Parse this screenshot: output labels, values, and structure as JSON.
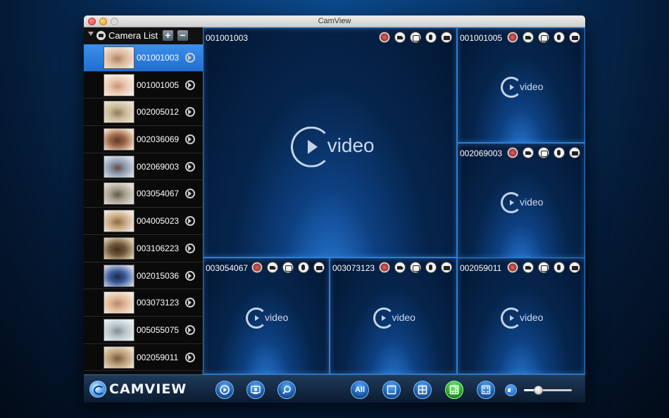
{
  "window": {
    "title": "CamView"
  },
  "sidebar": {
    "title": "Camera List",
    "add_label": "+",
    "remove_label": "−",
    "cameras": [
      {
        "id": "001001003",
        "selected": true,
        "thumb": [
          "#d9b89a",
          "#f2e4d6",
          "#b08064"
        ]
      },
      {
        "id": "001001005",
        "selected": false,
        "thumb": [
          "#e8c4a8",
          "#f7eee6",
          "#c9937a"
        ]
      },
      {
        "id": "002005012",
        "selected": false,
        "thumb": [
          "#c8b898",
          "#e8e0cc",
          "#8f7a55"
        ]
      },
      {
        "id": "002036069",
        "selected": false,
        "thumb": [
          "#a06848",
          "#f0dcc8",
          "#5a3a28"
        ]
      },
      {
        "id": "002069003",
        "selected": false,
        "thumb": [
          "#8a9ab0",
          "#d8dce4",
          "#6a4a3a"
        ]
      },
      {
        "id": "003054067",
        "selected": false,
        "thumb": [
          "#a8a090",
          "#e0dcd0",
          "#605848"
        ]
      },
      {
        "id": "004005023",
        "selected": false,
        "thumb": [
          "#c8a880",
          "#f0e8dc",
          "#8a6a48"
        ]
      },
      {
        "id": "003106223",
        "selected": false,
        "thumb": [
          "#705838",
          "#d8c8a8",
          "#403020"
        ]
      },
      {
        "id": "002015036",
        "selected": false,
        "thumb": [
          "#3a5a9a",
          "#c8d0e0",
          "#202840"
        ]
      },
      {
        "id": "003073123",
        "selected": false,
        "thumb": [
          "#e0b898",
          "#f6e6d8",
          "#b8886a"
        ]
      },
      {
        "id": "005055075",
        "selected": false,
        "thumb": [
          "#b8c4c8",
          "#e8eef0",
          "#808c90"
        ]
      },
      {
        "id": "002059011",
        "selected": false,
        "thumb": [
          "#b89870",
          "#e8dcc8",
          "#705840"
        ]
      }
    ]
  },
  "tiles": [
    {
      "name": "001001003",
      "placeholder": "video"
    },
    {
      "name": "001001005",
      "placeholder": "video"
    },
    {
      "name": "002069003",
      "placeholder": "video"
    },
    {
      "name": "003054067",
      "placeholder": "video"
    },
    {
      "name": "003073123",
      "placeholder": "video"
    },
    {
      "name": "002059011",
      "placeholder": "video"
    }
  ],
  "toolbar": {
    "brand": "CAMVIEW",
    "all_label": "All",
    "volume": 0.3
  }
}
